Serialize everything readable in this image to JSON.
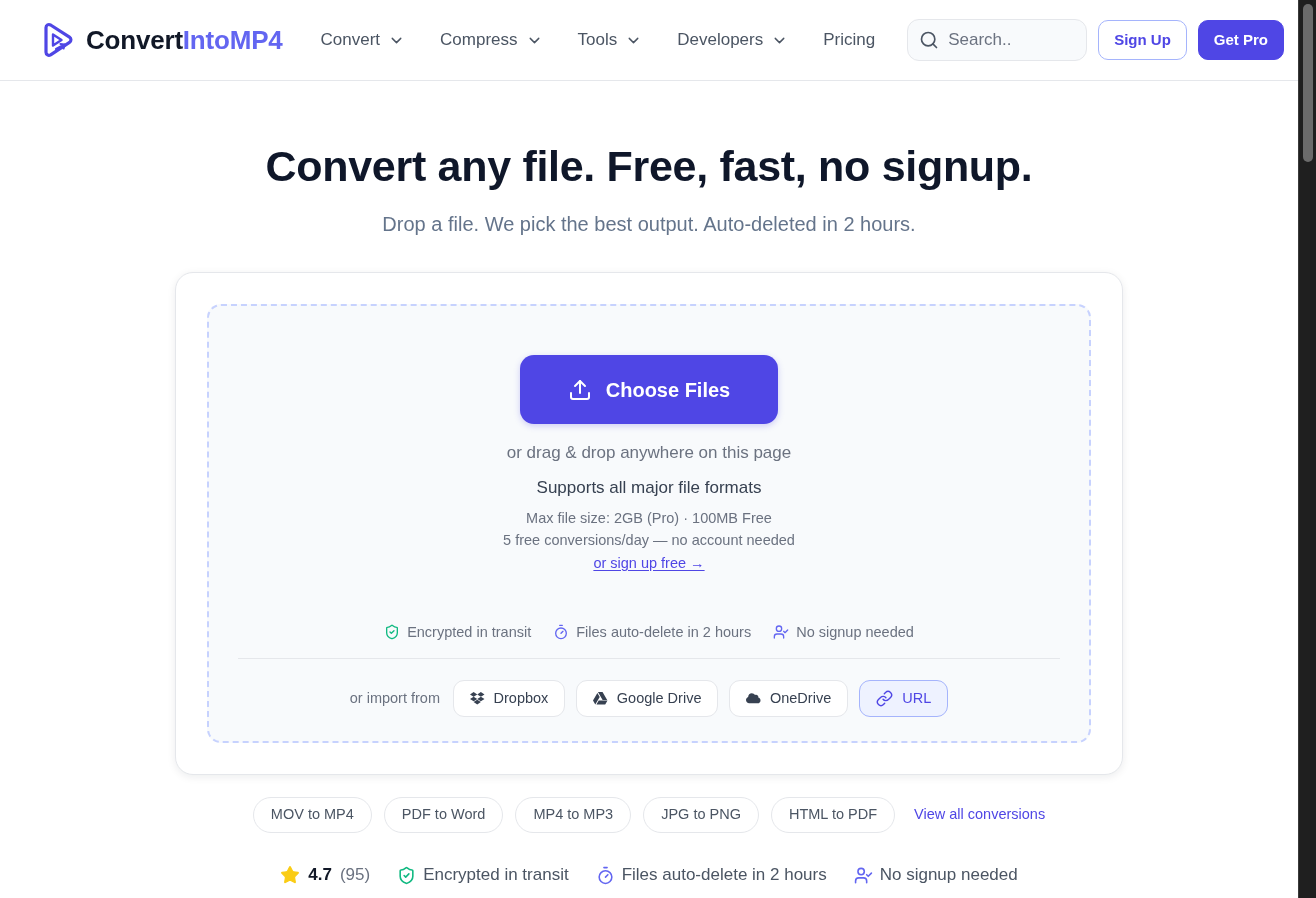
{
  "header": {
    "logo": {
      "text": "Convert",
      "accent": "IntoMP4"
    },
    "nav": [
      {
        "label": "Convert",
        "dropdown": true
      },
      {
        "label": "Compress",
        "dropdown": true
      },
      {
        "label": "Tools",
        "dropdown": true
      },
      {
        "label": "Developers",
        "dropdown": true
      },
      {
        "label": "Pricing",
        "dropdown": false
      }
    ],
    "search": {
      "placeholder": "Search.."
    },
    "buttons": [
      {
        "label": "Sign Up",
        "kind": "outline"
      },
      {
        "label": "Get Pro",
        "kind": "solid"
      }
    ]
  },
  "hero": {
    "title": "Convert any file. Free, fast, no signup.",
    "subtitle": "Drop a file. We pick the best output. Auto-deleted in 2 hours."
  },
  "uploader": {
    "button": "Choose Files",
    "hint": "or drag & drop anywhere on this page",
    "formats": "Supports all major file formats",
    "limits": [
      "Max file size: 2GB (Pro) · 100MB Free",
      "5 free conversions/day — no account needed"
    ],
    "signup_link": "or sign up free →",
    "trust": [
      {
        "kind": "encrypted",
        "label": "Encrypted in transit"
      },
      {
        "kind": "auto_delete",
        "label": "Files auto-delete in 2 hours"
      },
      {
        "kind": "no_signup",
        "label": "No signup needed"
      }
    ],
    "import_label": "or import from",
    "sources": [
      {
        "kind": "dropbox",
        "label": "Dropbox",
        "selected": false
      },
      {
        "kind": "drive",
        "label": "Google Drive",
        "selected": false
      },
      {
        "kind": "cloud",
        "label": "OneDrive",
        "selected": false
      },
      {
        "kind": "url",
        "label": "URL",
        "selected": true
      }
    ]
  },
  "popular_conversions": {
    "items": [
      "MOV to MP4",
      "PDF to Word",
      "MP4 to MP3",
      "JPG to PNG",
      "HTML to PDF"
    ],
    "view_all": "View all conversions"
  },
  "rating_bar": {
    "score": "4.7",
    "count": "(95)",
    "badges": [
      {
        "kind": "encrypted",
        "label": "Encrypted in transit"
      },
      {
        "kind": "auto_delete",
        "label": "Files auto-delete in 2 hours"
      },
      {
        "kind": "no_signup",
        "label": "No signup needed"
      }
    ]
  }
}
